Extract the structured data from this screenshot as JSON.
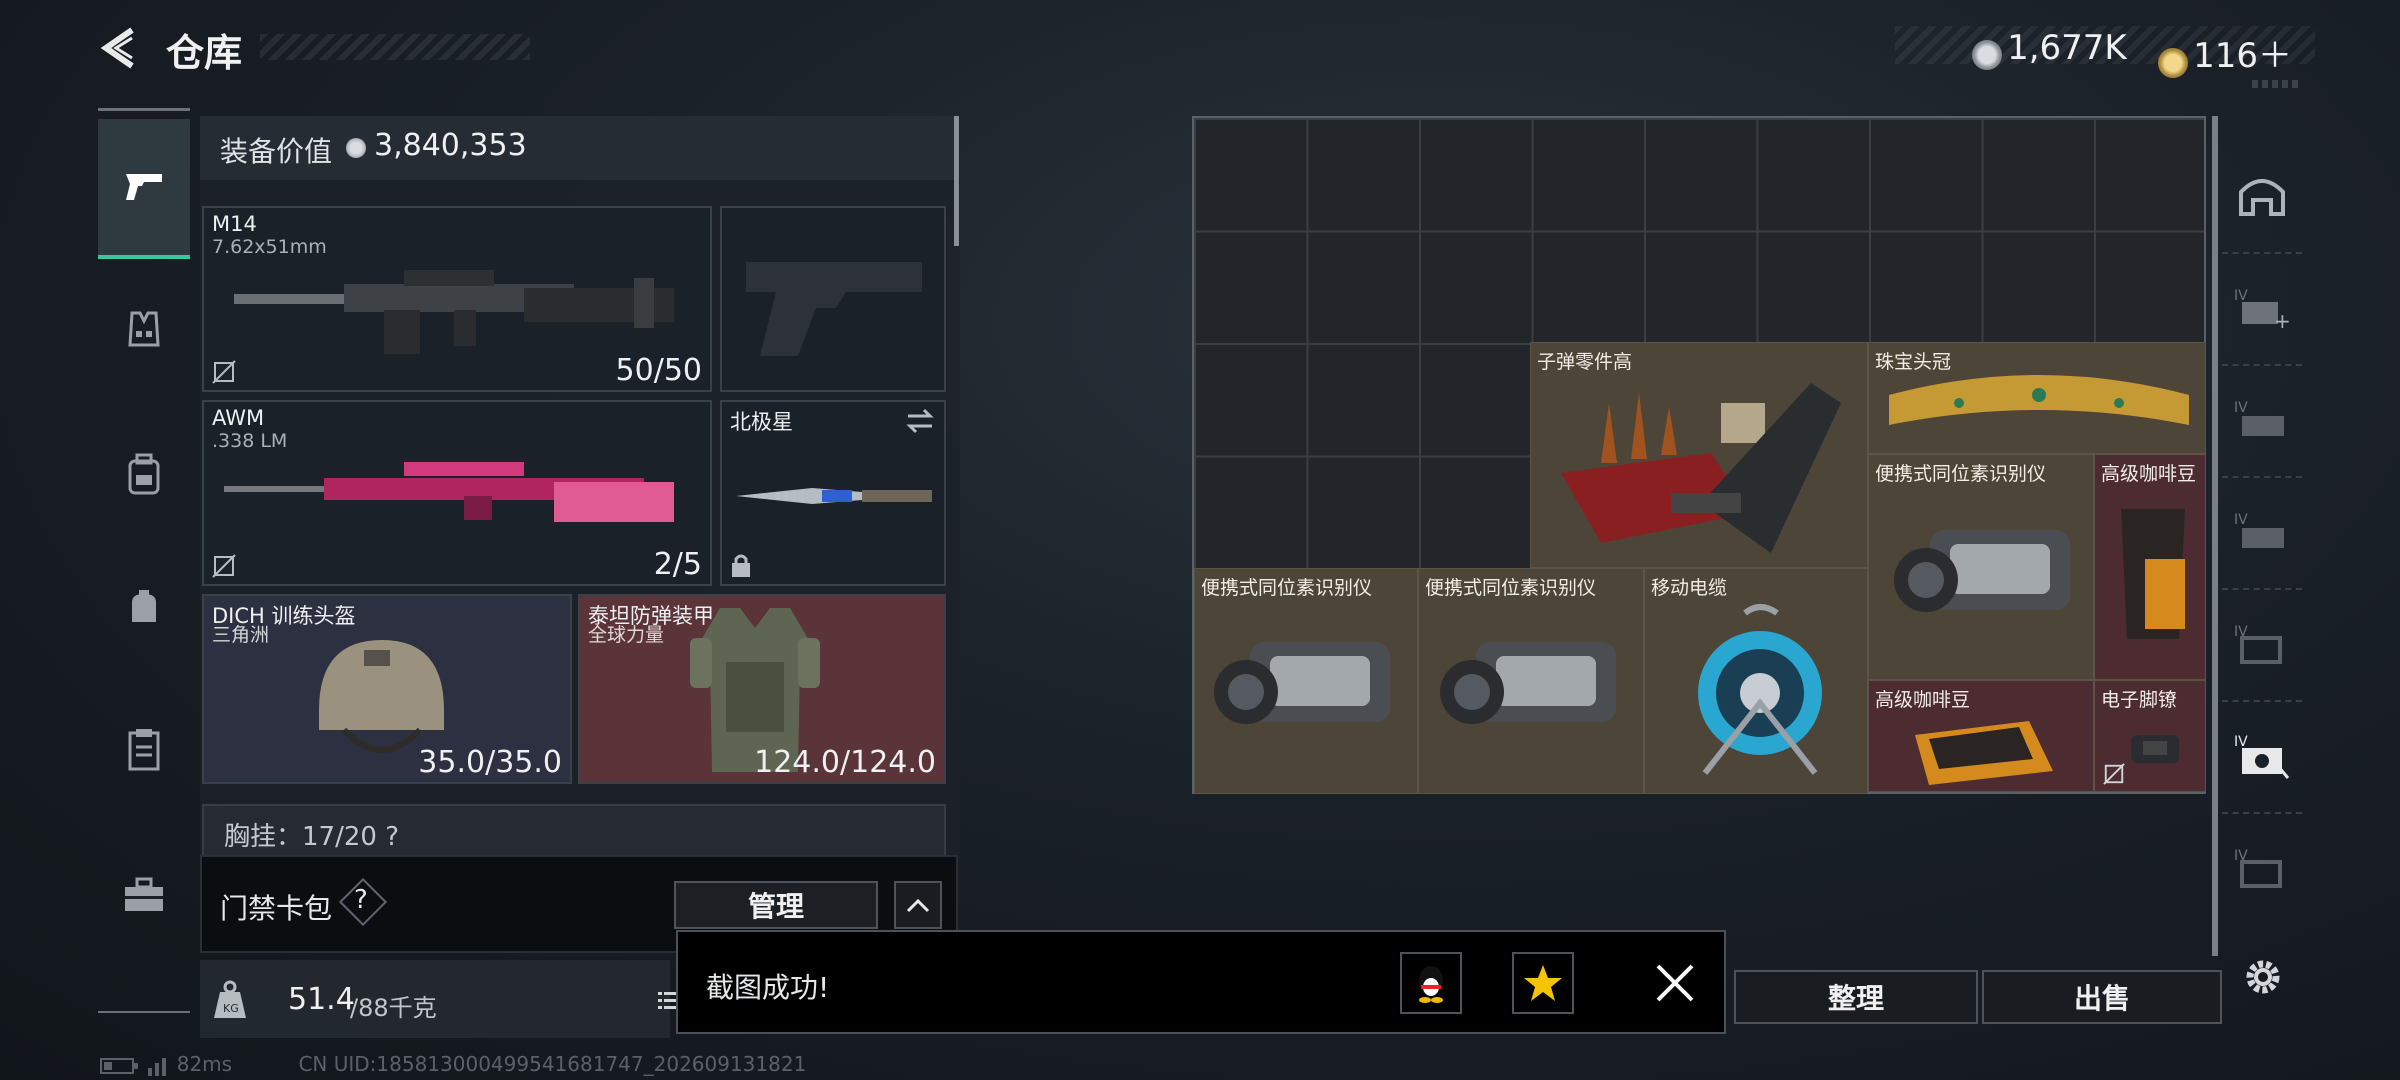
{
  "header": {
    "title": "仓库"
  },
  "currency": [
    {
      "icon": "silver-coin-icon",
      "value": "1,677K"
    },
    {
      "icon": "gold-coin-icon",
      "value": "116＋"
    }
  ],
  "left_nav": [
    {
      "name": "weapon-tab-pistol-icon",
      "active": true
    },
    {
      "name": "vest-tab-icon"
    },
    {
      "name": "backpack-tab-icon"
    },
    {
      "name": "pouch-tab-icon"
    },
    {
      "name": "case-tab-icon"
    },
    {
      "name": "toolbox-tab-icon"
    }
  ],
  "equipment": {
    "value_label": "装备价值",
    "value": "3,840,353",
    "primary": {
      "name": "M14",
      "caliber": "7.62x51mm",
      "ammo": "50/50"
    },
    "secondary": {
      "name": "AWM",
      "caliber": ".338 LM",
      "ammo": "2/5"
    },
    "melee": {
      "name": "北极星"
    },
    "helmet": {
      "name": "DICH 训练头盔",
      "sub": "三角洲",
      "durability": "35.0/35.0"
    },
    "armor": {
      "name": "泰坦防弹装甲",
      "sub": "全球力量",
      "durability": "124.0/124.0"
    },
    "chest_partial": "胸挂：17/20 ?"
  },
  "card_bag": {
    "label": "门禁卡包",
    "help": "?",
    "manage": "管理"
  },
  "weight": {
    "value": "51.4",
    "max": "/88千克"
  },
  "storage_items": [
    {
      "label": "子弹零件高",
      "color": "gold"
    },
    {
      "label": "珠宝头冠",
      "color": "gold"
    },
    {
      "label": "便携式同位素识别仪",
      "color": "gold"
    },
    {
      "label": "高级咖啡豆",
      "color": "red"
    },
    {
      "label": "便携式同位素识别仪",
      "color": "gold"
    },
    {
      "label": "便携式同位素识别仪",
      "color": "gold"
    },
    {
      "label": "移动电缆",
      "color": "gold"
    },
    {
      "label": "高级咖啡豆",
      "color": "red"
    },
    {
      "label": "电子脚镣",
      "color": "red"
    }
  ],
  "right_nav": [
    "storage-home-icon",
    "IV-add-icon",
    "IV-shelf-icon",
    "IV-shelf-icon",
    "IV-rack-icon",
    "IV-locker-icon",
    "IV-crate-icon"
  ],
  "buttons": {
    "sort": "整理",
    "sell": "出售"
  },
  "toast": {
    "message": "截图成功!"
  },
  "footer": {
    "ping": "82ms",
    "uid": "CN UID:185813000499541681747_202609131821"
  },
  "colors": {
    "accent": "#3fc3a0",
    "gold_item": "#4d4537",
    "red_item": "#4d2c31"
  }
}
